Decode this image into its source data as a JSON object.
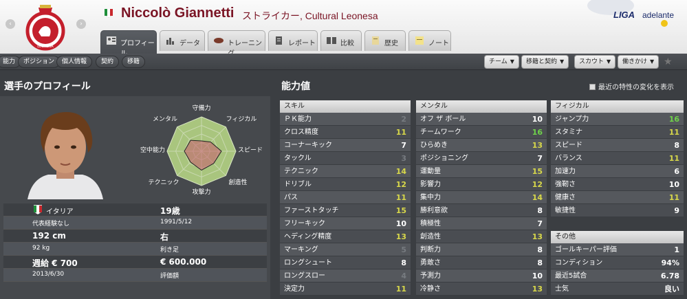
{
  "header": {
    "player_name": "Niccolò Giannetti",
    "player_subtitle": "ストライカー, Cultural Leonesa",
    "nav_prev": "‹",
    "nav_next": "›",
    "league_logo_text": "LIGA",
    "league_logo_sub": "adelante",
    "club_crest_text": "LEONESA"
  },
  "tabs": [
    {
      "label": "プロフィール",
      "icon": "profile-icon",
      "active": true
    },
    {
      "label": "データ",
      "icon": "stats-icon"
    },
    {
      "label": "トレーニング",
      "icon": "training-icon"
    },
    {
      "label": "レポート",
      "icon": "report-icon"
    },
    {
      "label": "比較",
      "icon": "compare-icon"
    },
    {
      "label": "歴史",
      "icon": "history-icon"
    },
    {
      "label": "ノート",
      "icon": "notes-icon"
    }
  ],
  "subnav": {
    "items": [
      "能力",
      "ポジション",
      "個人情報",
      "契約",
      "移籍"
    ],
    "dropdowns": [
      "チーム",
      "移籍と契約",
      "スカウト",
      "働きかけ"
    ],
    "favourite_icon": "star-icon"
  },
  "profile": {
    "section_title": "選手のプロフィール",
    "radar_labels": {
      "top": "守備力",
      "top_right": "フィジカル",
      "right": "スピード",
      "bottom_right": "創造性",
      "bottom": "攻撃力",
      "bottom_left": "テクニック",
      "left": "空中能力",
      "top_left": "メンタル"
    },
    "radar_values": [
      0.3,
      0.38,
      0.58,
      0.5,
      0.55,
      0.45,
      0.5,
      0.45
    ],
    "nationality": "イタリア",
    "age": "19歳",
    "caps": "代表経験なし",
    "dob": "1991/5/12",
    "height": "192 cm",
    "foot": "右",
    "weight": "92 kg",
    "foot_label": "利き足",
    "wage": "週給 € 700",
    "value": "€ 600.000",
    "contract_end": "2013/6/30",
    "value_label": "評価額"
  },
  "attributes": {
    "section_title": "能力値",
    "checkbox_label": "最近の特性の変化を表示",
    "skill": {
      "header": "スキル",
      "rows": [
        {
          "name": "ＰＫ能力",
          "value": "2"
        },
        {
          "name": "クロス精度",
          "value": "11"
        },
        {
          "name": "コーナーキック",
          "value": "7"
        },
        {
          "name": "タックル",
          "value": "3"
        },
        {
          "name": "テクニック",
          "value": "14"
        },
        {
          "name": "ドリブル",
          "value": "12"
        },
        {
          "name": "パス",
          "value": "11"
        },
        {
          "name": "ファーストタッチ",
          "value": "15"
        },
        {
          "name": "フリーキック",
          "value": "10"
        },
        {
          "name": "ヘディング精度",
          "value": "13"
        },
        {
          "name": "マーキング",
          "value": "5"
        },
        {
          "name": "ロングシュート",
          "value": "8"
        },
        {
          "name": "ロングスロー",
          "value": "4"
        },
        {
          "name": "決定力",
          "value": "11"
        }
      ]
    },
    "mental": {
      "header": "メンタル",
      "rows": [
        {
          "name": "オフ ザ ボール",
          "value": "10"
        },
        {
          "name": "チームワーク",
          "value": "16"
        },
        {
          "name": "ひらめき",
          "value": "13"
        },
        {
          "name": "ポジショニング",
          "value": "7"
        },
        {
          "name": "運動量",
          "value": "15"
        },
        {
          "name": "影響力",
          "value": "12"
        },
        {
          "name": "集中力",
          "value": "14"
        },
        {
          "name": "勝利意欲",
          "value": "8"
        },
        {
          "name": "積極性",
          "value": "7"
        },
        {
          "name": "創造性",
          "value": "13"
        },
        {
          "name": "判断力",
          "value": "8"
        },
        {
          "name": "勇敢さ",
          "value": "8"
        },
        {
          "name": "予測力",
          "value": "10"
        },
        {
          "name": "冷静さ",
          "value": "13"
        }
      ]
    },
    "physical": {
      "header": "フィジカル",
      "rows": [
        {
          "name": "ジャンプ力",
          "value": "16"
        },
        {
          "name": "スタミナ",
          "value": "11"
        },
        {
          "name": "スピード",
          "value": "8"
        },
        {
          "name": "バランス",
          "value": "11"
        },
        {
          "name": "加速力",
          "value": "6"
        },
        {
          "name": "強靭さ",
          "value": "10"
        },
        {
          "name": "健康さ",
          "value": "11"
        },
        {
          "name": "敏捷性",
          "value": "9"
        }
      ]
    },
    "other": {
      "header": "その他",
      "rows": [
        {
          "name": "ゴールキーパー評価",
          "value": "1"
        },
        {
          "name": "コンディション",
          "value": "94%"
        },
        {
          "name": "最近5試合",
          "value": "6.78"
        },
        {
          "name": "士気",
          "value": "良い"
        }
      ]
    }
  },
  "colors": {
    "accent": "#7a1424",
    "value_high": "#6fd34a",
    "value_mid": "#d8d84a",
    "value_low": "#777b80"
  }
}
